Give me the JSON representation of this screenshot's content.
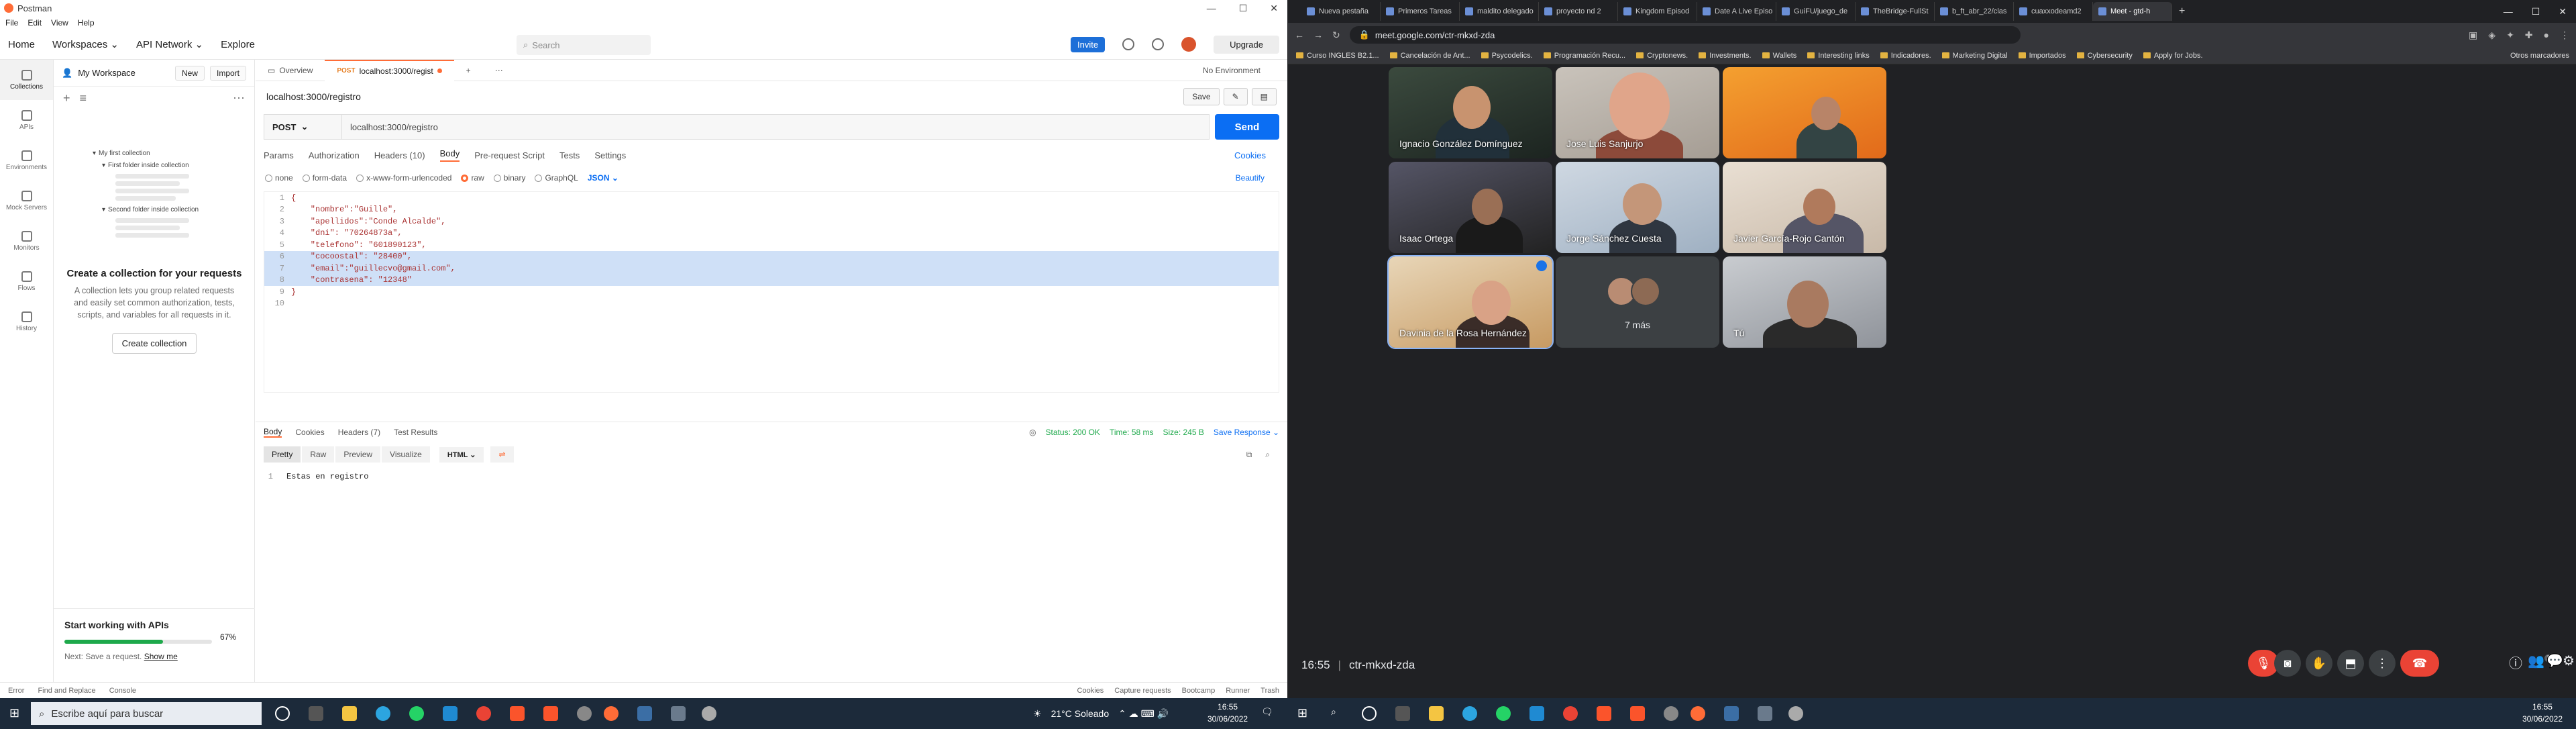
{
  "postman": {
    "window_title": "Postman",
    "menu": [
      "File",
      "Edit",
      "View",
      "Help"
    ],
    "top_nav": {
      "home": "Home",
      "workspaces": "Workspaces ⌄",
      "api_network": "API Network ⌄",
      "explore": "Explore"
    },
    "search_placeholder": "Search",
    "invite": "Invite",
    "upgrade": "Upgrade",
    "rail": [
      "Collections",
      "APIs",
      "Environments",
      "Mock Servers",
      "Monitors",
      "Flows",
      "History"
    ],
    "workspace_name": "My Workspace",
    "new_btn": "New",
    "import_btn": "Import",
    "tree": {
      "root": "My first collection",
      "f1": "First folder inside collection",
      "f2": "Second folder inside collection"
    },
    "empty": {
      "title": "Create a collection for your requests",
      "text": "A collection lets you group related requests and easily set common authorization, tests, scripts, and variables for all requests in it.",
      "button": "Create collection"
    },
    "start": {
      "title": "Start working with APIs",
      "progress": 0.67,
      "pct": "67%",
      "next": "Next: Save a request.",
      "next_link": "Show me"
    },
    "tabs": {
      "overview": "Overview",
      "req_method": "POST",
      "req_title": "localhost:3000/regist",
      "env": "No Environment"
    },
    "request": {
      "name": "localhost:3000/registro",
      "save": "Save",
      "method": "POST",
      "url": "localhost:3000/registro",
      "send": "Send"
    },
    "subtabs": {
      "params": "Params",
      "auth": "Authorization",
      "headers": "Headers (10)",
      "body": "Body",
      "prerequest": "Pre-request Script",
      "tests": "Tests",
      "settings": "Settings",
      "cookies": "Cookies"
    },
    "body_opts": {
      "none": "none",
      "form": "form-data",
      "urlenc": "x-www-form-urlencoded",
      "raw": "raw",
      "binary": "binary",
      "graphql": "GraphQL",
      "json": "JSON ⌄",
      "beautify": "Beautify"
    },
    "code": [
      {
        "n": "1",
        "t": "{"
      },
      {
        "n": "2",
        "t": "    \"nombre\":\"Guille\","
      },
      {
        "n": "3",
        "t": "    \"apellidos\":\"Conde Alcalde\","
      },
      {
        "n": "4",
        "t": "    \"dni\": \"70264873a\","
      },
      {
        "n": "5",
        "t": "    \"telefono\": \"601890123\","
      },
      {
        "n": "6",
        "t": "    \"cocoostal\": \"28400\","
      },
      {
        "n": "7",
        "t": "    \"email\":\"guillecvo@gmail.com\","
      },
      {
        "n": "8",
        "t": "    \"contrasena\": \"12348\""
      },
      {
        "n": "9",
        "t": "}"
      },
      {
        "n": "10",
        "t": ""
      }
    ],
    "response": {
      "tabs": {
        "body": "Body",
        "cookies": "Cookies",
        "headers": "Headers (7)",
        "results": "Test Results"
      },
      "status": "Status: 200 OK",
      "time": "Time: 58 ms",
      "size": "Size: 245 B",
      "save": "Save Response ⌄",
      "views": {
        "pretty": "Pretty",
        "raw": "Raw",
        "preview": "Preview",
        "visualize": "Visualize",
        "html": "HTML ⌄"
      },
      "line_no": "1",
      "text": "Estas en registro"
    },
    "status_bar": {
      "left": [
        "Error",
        "Find and Replace",
        "Console"
      ],
      "right": [
        "Cookies",
        "Capture requests",
        "Bootcamp",
        "Runner",
        "Trash"
      ]
    }
  },
  "chrome": {
    "tabs": [
      "Nueva pestaña",
      "Primeros Tareas",
      "maldito delegado",
      "proyecto nd 2",
      "Kingdom Episod",
      "Date A Live Episo",
      "GuiFU/juego_de",
      "TheBridge-FullSt",
      "b_ft_abr_22/clas",
      "cuaxxodeamd2",
      "Meet - gtd-h"
    ],
    "address": "meet.google.com/ctr-mkxd-zda",
    "bookmarks": [
      "Curso INGLES B2.1...",
      "Cancelación de Ant...",
      "Psycodelics.",
      "Programación Recu...",
      "Cryptonews.",
      "Investments.",
      "Wallets",
      "Interesting links",
      "Indicadores.",
      "Marketing Digital",
      "Importados",
      "Cybersecurity",
      "Apply for Jobs."
    ],
    "other_bookmarks": "Otros marcadores"
  },
  "meet": {
    "participants": [
      "Ignacio González Domínguez",
      "Jose Luis Sanjurjo",
      "",
      "Isaac Ortega",
      "Jorge Sánchez Cuesta",
      "Javier García-Rojo Cantón",
      "Davinia de la Rosa Hernández",
      "7 más",
      "Tú"
    ],
    "time": "16:55",
    "code": "ctr-mkxd-zda",
    "people_count": "16"
  },
  "taskbar": {
    "search": "Escribe aquí para buscar",
    "weather": "21°C  Soleado",
    "time": "16:55",
    "date": "30/06/2022"
  }
}
